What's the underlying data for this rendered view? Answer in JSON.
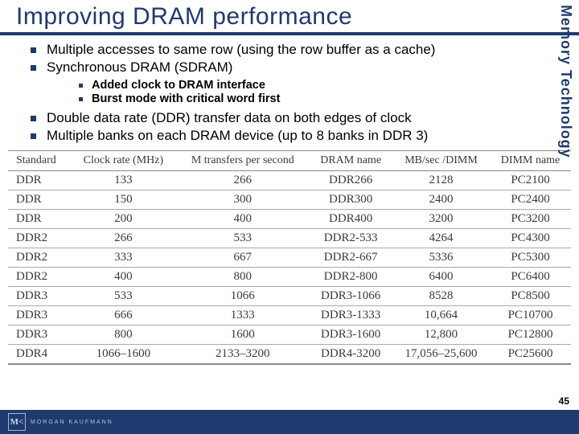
{
  "title": "Improving DRAM performance",
  "side_label": "Memory Technology",
  "bullets": {
    "b1": "Multiple accesses to same row (using the row buffer as a cache)",
    "b2": "Synchronous DRAM (SDRAM)",
    "b2a": "Added clock to DRAM interface",
    "b2b": "Burst mode with critical word first",
    "b3": "Double data rate (DDR) transfer data on both edges of clock",
    "b4": "Multiple banks on each DRAM device (up to 8 banks in DDR 3)"
  },
  "table": {
    "headers": [
      "Standard",
      "Clock rate (MHz)",
      "M transfers per second",
      "DRAM name",
      "MB/sec /DIMM",
      "DIMM name"
    ],
    "rows": [
      [
        "DDR",
        "133",
        "266",
        "DDR266",
        "2128",
        "PC2100"
      ],
      [
        "DDR",
        "150",
        "300",
        "DDR300",
        "2400",
        "PC2400"
      ],
      [
        "DDR",
        "200",
        "400",
        "DDR400",
        "3200",
        "PC3200"
      ],
      [
        "DDR2",
        "266",
        "533",
        "DDR2-533",
        "4264",
        "PC4300"
      ],
      [
        "DDR2",
        "333",
        "667",
        "DDR2-667",
        "5336",
        "PC5300"
      ],
      [
        "DDR2",
        "400",
        "800",
        "DDR2-800",
        "6400",
        "PC6400"
      ],
      [
        "DDR3",
        "533",
        "1066",
        "DDR3-1066",
        "8528",
        "PC8500"
      ],
      [
        "DDR3",
        "666",
        "1333",
        "DDR3-1333",
        "10,664",
        "PC10700"
      ],
      [
        "DDR3",
        "800",
        "1600",
        "DDR3-1600",
        "12,800",
        "PC12800"
      ],
      [
        "DDR4",
        "1066–1600",
        "2133–3200",
        "DDR4-3200",
        "17,056–25,600",
        "PC25600"
      ]
    ]
  },
  "footer": {
    "logo_mark": "M<",
    "logo_text": "MORGAN KAUFMANN"
  },
  "page_number": "45"
}
